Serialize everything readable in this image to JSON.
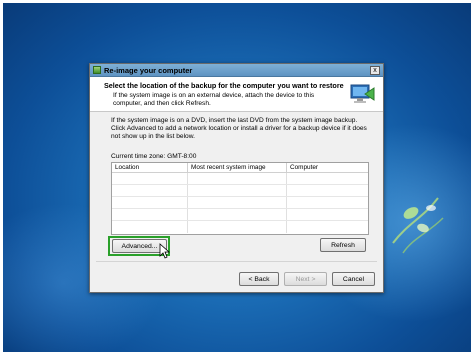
{
  "dialog": {
    "title": "Re-image your computer",
    "close_label": "x",
    "header_title": "Select the location of the backup for the computer you want to restore",
    "header_sub": "If the system image is on an external device, attach the device to this computer, and then click Refresh.",
    "body_text": "If the system image is on a DVD, insert the last DVD from the system image backup. Click Advanced to add a network location or install a driver for a backup device if it does not show up in the list below.",
    "timezone": "Current time zone: GMT-8:00",
    "table": {
      "columns": [
        "Location",
        "Most recent system image",
        "Computer"
      ],
      "rows": []
    },
    "buttons": {
      "advanced": "Advanced...",
      "refresh": "Refresh",
      "back": "< Back",
      "next": "Next >",
      "cancel": "Cancel"
    }
  },
  "colors": {
    "highlight": "#2aa02a",
    "desktop": "#1c6fb8"
  }
}
